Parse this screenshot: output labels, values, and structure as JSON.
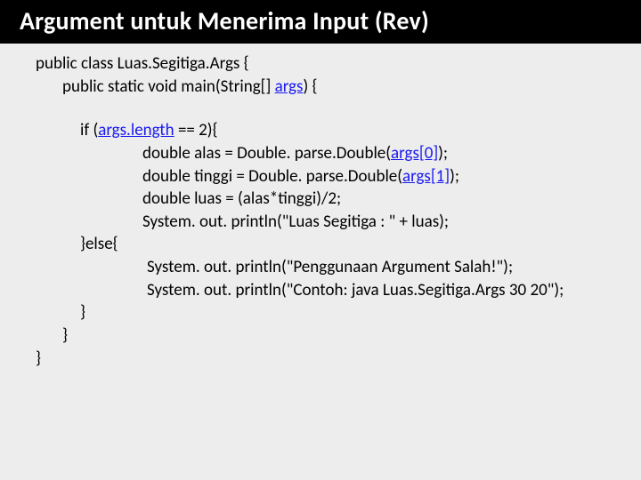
{
  "title": "Argument untuk Menerima Input (Rev)",
  "code": {
    "l1a": "public class Luas.Segitiga.Args {",
    "l2a": "public static void main(String[] ",
    "l2b": "args",
    "l2c": ") {",
    "l3a": "if (",
    "l3b": "args.length",
    "l3c": " == 2){",
    "l4a": "double alas  = Double. parse.Double(",
    "l4b": "args[0]",
    "l4c": ");",
    "l5a": "double tinggi = Double. parse.Double(",
    "l5b": "args[1]",
    "l5c": ");",
    "l6": "double luas = (alas*tinggi)/2;",
    "l7": "System. out. println(\"Luas Segitiga : \" + luas);",
    "l8": "}else{",
    "l9": "System. out. println(\"Penggunaan Argument  Salah!\");",
    "l10": "System. out. println(\"Contoh: java Luas.Segitiga.Args 30 20\");",
    "l11": "}",
    "l12": "}",
    "l13": "}"
  }
}
